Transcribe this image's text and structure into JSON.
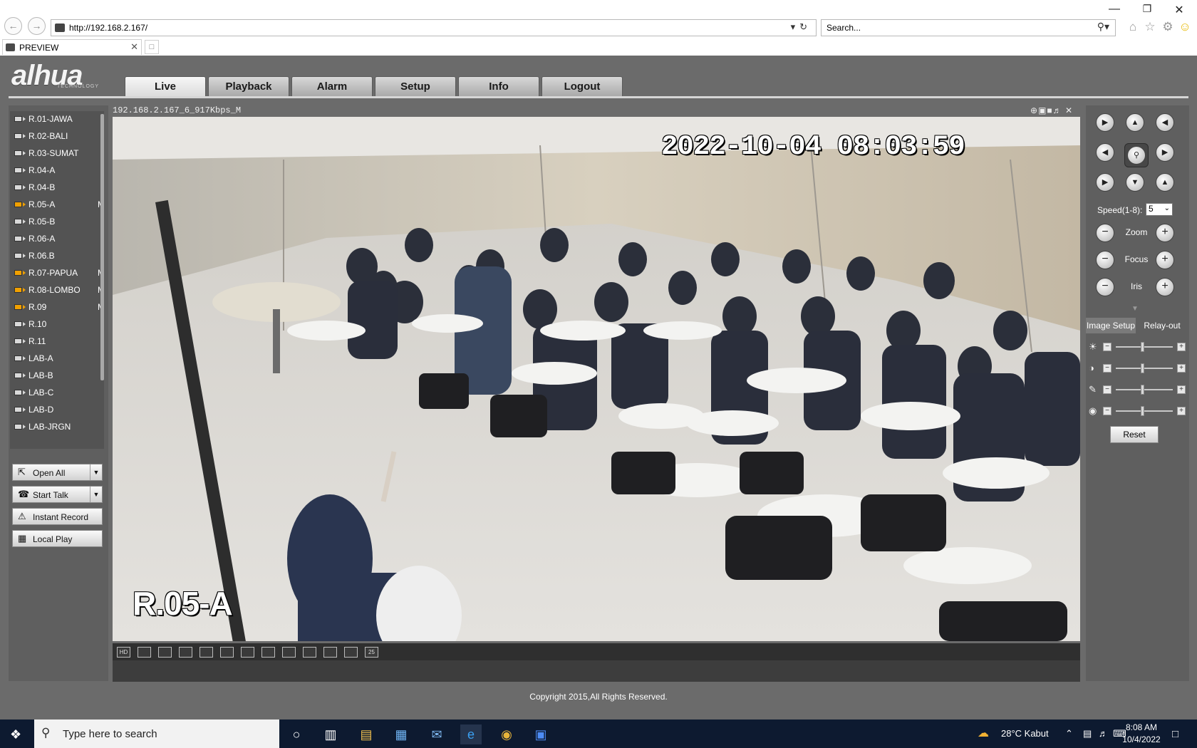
{
  "browser": {
    "url": "http://192.168.2.167/",
    "search_placeholder": "Search...",
    "tab_title": "PREVIEW"
  },
  "app": {
    "logo": "alhua",
    "logo_sub": "TECHNOLOGY",
    "tabs": [
      "Live",
      "Playback",
      "Alarm",
      "Setup",
      "Info",
      "Logout"
    ],
    "active_tab": "Live",
    "footer": "Copyright 2015,All Rights Reserved."
  },
  "channels": [
    {
      "name": "R.01-JAWA",
      "m": ""
    },
    {
      "name": "R.02-BALI",
      "m": ""
    },
    {
      "name": "R.03-SUMAT",
      "m": ""
    },
    {
      "name": "R.04-A",
      "m": ""
    },
    {
      "name": "R.04-B",
      "m": ""
    },
    {
      "name": "R.05-A",
      "m": "M"
    },
    {
      "name": "R.05-B",
      "m": ""
    },
    {
      "name": "R.06-A",
      "m": ""
    },
    {
      "name": "R.06.B",
      "m": ""
    },
    {
      "name": "R.07-PAPUA",
      "m": "M"
    },
    {
      "name": "R.08-LOMBO",
      "m": "M"
    },
    {
      "name": "R.09",
      "m": "M"
    },
    {
      "name": "R.10",
      "m": ""
    },
    {
      "name": "R.11",
      "m": ""
    },
    {
      "name": "LAB-A",
      "m": ""
    },
    {
      "name": "LAB-B",
      "m": ""
    },
    {
      "name": "LAB-C",
      "m": ""
    },
    {
      "name": "LAB-D",
      "m": ""
    },
    {
      "name": "LAB-JRGN",
      "m": ""
    }
  ],
  "left_buttons": {
    "open_all": "Open All",
    "start_talk": "Start Talk",
    "instant_record": "Instant Record",
    "local_play": "Local Play"
  },
  "video": {
    "stream_label": "192.168.2.167_6_917Kbps_M",
    "timestamp": "2022-10-04 08:03:59",
    "channel_overlay": "R.05-A"
  },
  "video_toolbar": [
    "HD",
    "",
    "",
    "",
    "",
    "",
    "",
    "",
    "",
    "",
    "",
    "",
    "25"
  ],
  "ptz": {
    "speed_label": "Speed(1-8):",
    "speed_value": "5",
    "zoom": "Zoom",
    "focus": "Focus",
    "iris": "Iris"
  },
  "image_panel": {
    "tab_image": "Image Setup",
    "tab_relay": "Relay-out",
    "reset": "Reset"
  },
  "taskbar": {
    "search_placeholder": "Type here to search",
    "weather": "28°C  Kabut",
    "time": "8:08 AM",
    "date": "10/4/2022"
  }
}
